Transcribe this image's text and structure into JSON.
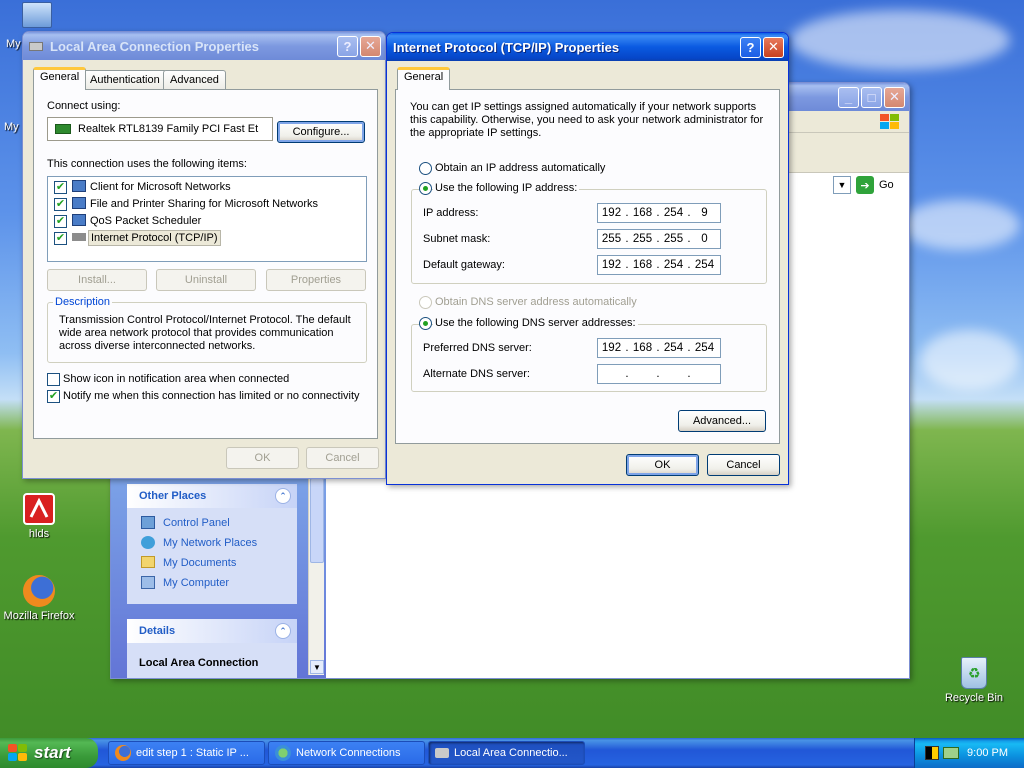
{
  "desktop": {
    "icons": [
      {
        "label": "hlds"
      },
      {
        "label": "Mozilla Firefox"
      },
      {
        "label": "Recycle Bin"
      }
    ],
    "edge_labels": [
      "My",
      "My"
    ]
  },
  "explorer": {
    "go_label": "Go",
    "other_places": {
      "title": "Other Places",
      "items": [
        "Control Panel",
        "My Network Places",
        "My Documents",
        "My Computer"
      ]
    },
    "details": {
      "title": "Details",
      "item": "Local Area Connection"
    }
  },
  "lac": {
    "title": "Local Area Connection Properties",
    "tabs": [
      "General",
      "Authentication",
      "Advanced"
    ],
    "connect_using_label": "Connect using:",
    "adapter": "Realtek RTL8139 Family PCI Fast Et",
    "configure_label": "Configure...",
    "items_label": "This connection uses the following items:",
    "items": [
      {
        "label": "Client for Microsoft Networks",
        "checked": true
      },
      {
        "label": "File and Printer Sharing for Microsoft Networks",
        "checked": true
      },
      {
        "label": "QoS Packet Scheduler",
        "checked": true
      },
      {
        "label": "Internet Protocol (TCP/IP)",
        "checked": true
      }
    ],
    "install_label": "Install...",
    "uninstall_label": "Uninstall",
    "properties_label": "Properties",
    "description_title": "Description",
    "description_text": "Transmission Control Protocol/Internet Protocol. The default wide area network protocol that provides communication across diverse interconnected networks.",
    "show_icon_label": "Show icon in notification area when connected",
    "show_icon_checked": false,
    "notify_label": "Notify me when this connection has limited or no connectivity",
    "notify_checked": true,
    "ok_label": "OK",
    "cancel_label": "Cancel"
  },
  "tcpip": {
    "title": "Internet Protocol (TCP/IP) Properties",
    "tab": "General",
    "intro": "You can get IP settings assigned automatically if your network supports this capability. Otherwise, you need to ask your network administrator for the appropriate IP settings.",
    "obtain_ip_label": "Obtain an IP address automatically",
    "use_ip_label": "Use the following IP address:",
    "ip_label": "IP address:",
    "ip": [
      "192",
      "168",
      "254",
      "9"
    ],
    "mask_label": "Subnet mask:",
    "mask": [
      "255",
      "255",
      "255",
      "0"
    ],
    "gateway_label": "Default gateway:",
    "gateway": [
      "192",
      "168",
      "254",
      "254"
    ],
    "obtain_dns_label": "Obtain DNS server address automatically",
    "use_dns_label": "Use the following DNS server addresses:",
    "pref_dns_label": "Preferred DNS server:",
    "pref_dns": [
      "192",
      "168",
      "254",
      "254"
    ],
    "alt_dns_label": "Alternate DNS server:",
    "alt_dns": [
      "",
      "",
      "",
      ""
    ],
    "advanced_label": "Advanced...",
    "ok_label": "OK",
    "cancel_label": "Cancel"
  },
  "taskbar": {
    "start_label": "start",
    "tasks": [
      {
        "label": "edit step 1 : Static IP ..."
      },
      {
        "label": "Network Connections"
      },
      {
        "label": "Local Area Connectio..."
      }
    ],
    "clock": "9:00 PM"
  }
}
